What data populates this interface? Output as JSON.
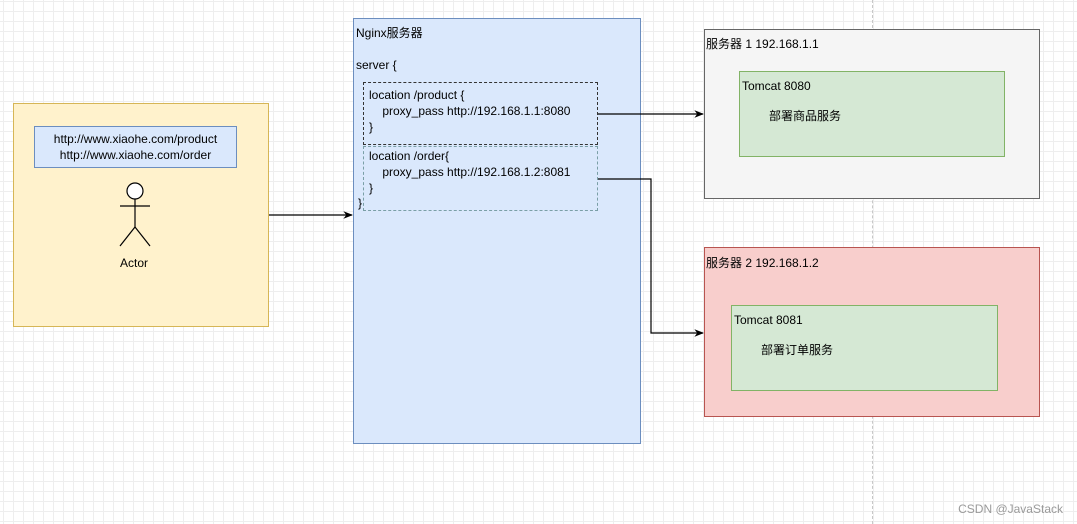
{
  "actor": {
    "urls": [
      "http://www.xiaohe.com/product",
      "http://www.xiaohe.com/order"
    ],
    "label": "Actor"
  },
  "nginx": {
    "title": "Nginx服务器",
    "server_open": "server {",
    "server_close": "}",
    "locations": [
      {
        "open": "location /product {",
        "directive": "    proxy_pass http://192.168.1.1:8080",
        "close": "}"
      },
      {
        "open": "location /order{",
        "directive": "    proxy_pass http://192.168.1.2:8081",
        "close": "}"
      }
    ]
  },
  "servers": [
    {
      "title": "服务器 1 192.168.1.1",
      "tomcat": "Tomcat 8080",
      "service": "部署商品服务"
    },
    {
      "title": "服务器 2 192.168.1.2",
      "tomcat": "Tomcat 8081",
      "service": "部署订单服务"
    }
  ],
  "watermark": "CSDN @JavaStack"
}
